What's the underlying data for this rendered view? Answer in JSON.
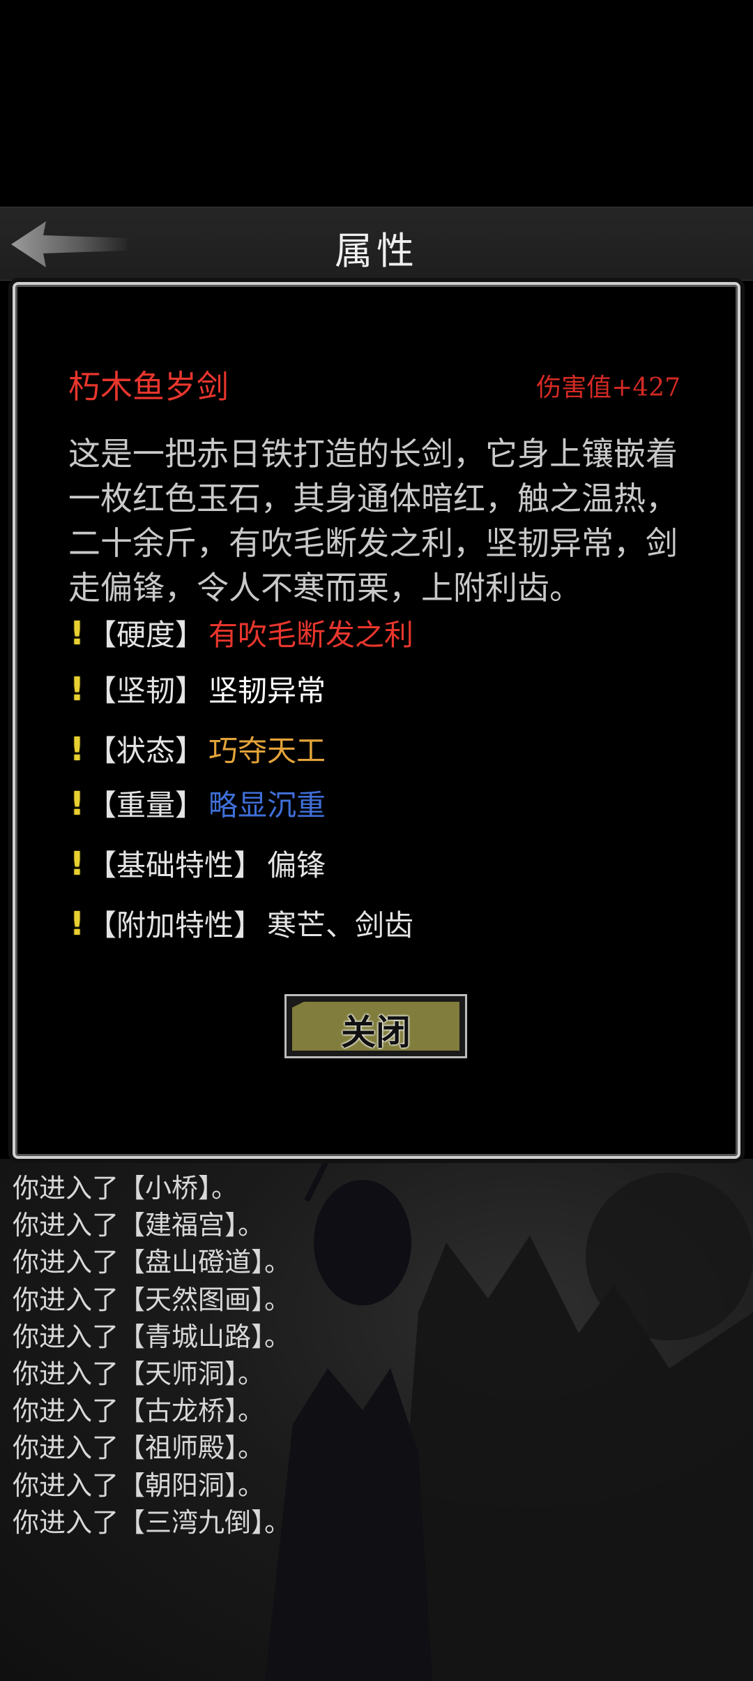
{
  "header": {
    "title": "属性",
    "back_icon": "back-arrow-icon"
  },
  "item": {
    "name": "朽木鱼岁剑",
    "damage": "伤害值+427",
    "description": "这是一把赤日铁打造的长剑，它身上镶嵌着\n一枚红色玉石，其身通体暗红，触之温热，\n二十余斤，有吹毛断发之利，坚韧异常，剑\n走偏锋，令人不寒而栗，上附利齿。"
  },
  "attributes": [
    {
      "label": "【硬度】",
      "value": "有吹毛断发之利",
      "color": "#e8362d"
    },
    {
      "label": "【坚韧】",
      "value": "坚韧异常",
      "color": "#ffffff"
    },
    {
      "label": "【状态】",
      "value": "巧夺天工",
      "color": "#e3a33a"
    },
    {
      "label": "【重量】",
      "value": "略显沉重",
      "color": "#3f6fd8"
    },
    {
      "label": "【基础特性】",
      "value": "偏锋",
      "color": "#e4e4e4"
    },
    {
      "label": "【附加特性】",
      "value": "寒芒、剑齿",
      "color": "#e4e4e4"
    }
  ],
  "attribute_marker": "!",
  "close_button": {
    "label": "关闭"
  },
  "log": [
    "你进入了【小桥】。",
    "你进入了【建福宫】。",
    "你进入了【盘山磴道】。",
    "你进入了【天然图画】。",
    "你进入了【青城山路】。",
    "你进入了【天师洞】。",
    "你进入了【古龙桥】。",
    "你进入了【祖师殿】。",
    "你进入了【朝阳洞】。",
    "你进入了【三湾九倒】。"
  ]
}
